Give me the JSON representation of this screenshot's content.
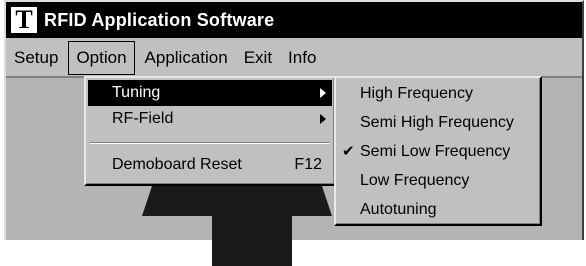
{
  "window": {
    "title": "RFID Application Software",
    "logo_letter": "T"
  },
  "menubar": {
    "items": [
      {
        "label": "Setup"
      },
      {
        "label": "Option"
      },
      {
        "label": "Application"
      },
      {
        "label": "Exit"
      },
      {
        "label": "Info"
      }
    ],
    "active": "Option"
  },
  "option_menu": {
    "items": [
      {
        "label": "Tuning",
        "has_submenu": true,
        "highlighted": true
      },
      {
        "label": "RF-Field",
        "has_submenu": true,
        "highlighted": false
      },
      {
        "label": "Demoboard Reset",
        "shortcut": "F12"
      }
    ]
  },
  "tuning_submenu": {
    "items": [
      {
        "label": "High Frequency",
        "checked": false
      },
      {
        "label": "Semi High Frequency",
        "checked": false
      },
      {
        "label": "Semi Low Frequency",
        "checked": true,
        "check_mark": "✔"
      },
      {
        "label": "Low Frequency",
        "checked": false
      },
      {
        "label": "Autotuning",
        "checked": false
      }
    ]
  },
  "colors": {
    "titlebar": "#000000",
    "menu_face": "#c0c0c0",
    "highlight": "#000000"
  },
  "icons": [
    "app-logo-icon",
    "submenu-arrow-icon",
    "checkmark-icon"
  ]
}
